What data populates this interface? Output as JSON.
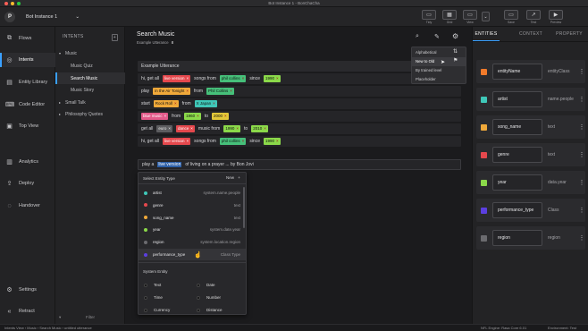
{
  "window": {
    "title": "Bot Instance 1 - BonChaCha",
    "traffic_colors": [
      "#ff5f57",
      "#febc2e",
      "#28c840"
    ]
  },
  "toolbar": {
    "avatar_letter": "P",
    "instance": "Bot Instance 1",
    "buttons_left": [
      {
        "label": "Tidy",
        "icon": "tidy-icon",
        "glyph": "▭"
      },
      {
        "label": "Grid",
        "icon": "grid-icon",
        "glyph": "▦"
      },
      {
        "label": "View",
        "icon": "view-icon",
        "glyph": "▭"
      }
    ],
    "buttons_right": [
      {
        "label": "Save",
        "icon": "save-icon",
        "glyph": "▭"
      },
      {
        "label": "Test",
        "icon": "test-icon",
        "glyph": "↗"
      },
      {
        "label": "Preview",
        "icon": "preview-icon",
        "glyph": "▶"
      }
    ]
  },
  "nav": [
    {
      "label": "Flows",
      "icon": "flows-icon",
      "glyph": "⧉"
    },
    {
      "label": "Intents",
      "icon": "intents-icon",
      "glyph": "◎",
      "active": true
    },
    {
      "label": "Entity Library",
      "icon": "entity-library-icon",
      "glyph": "▤"
    },
    {
      "label": "Code Editor",
      "icon": "code-editor-icon",
      "glyph": "⌨"
    },
    {
      "label": "Top View",
      "icon": "top-view-icon",
      "glyph": "▣"
    },
    {
      "label": "Analytics",
      "icon": "analytics-icon",
      "glyph": "▥"
    },
    {
      "label": "Deploy",
      "icon": "deploy-icon",
      "glyph": "⇪"
    },
    {
      "label": "Handover",
      "icon": "handover-icon",
      "glyph": "◌"
    },
    {
      "label": "Settings",
      "icon": "settings-icon",
      "glyph": "⚙"
    },
    {
      "label": "Retract",
      "icon": "retract-icon",
      "glyph": "«"
    }
  ],
  "intents": {
    "header": "INTENTS",
    "add": "+",
    "filter": "Filter",
    "tree": [
      {
        "label": "Music",
        "level": 0,
        "caret": "▾"
      },
      {
        "label": "Music Quiz",
        "level": 1
      },
      {
        "label": "Search Music",
        "level": 1,
        "selected": true
      },
      {
        "label": "Music Story",
        "level": 1
      },
      {
        "label": "Small Talk",
        "level": 0,
        "caret": "▸"
      },
      {
        "label": "Philosophy Quotes",
        "level": 0,
        "caret": "▸"
      }
    ]
  },
  "main": {
    "title": "Search Music",
    "subtitle_label": "Example Utterance",
    "subtitle_count": "8",
    "list_header": "Example Utterance",
    "utterances": [
      [
        {
          "t": "hi, get all"
        },
        {
          "k": "live version",
          "c": "red"
        },
        {
          "t": "songs from"
        },
        {
          "k": "phil collins",
          "c": "green"
        },
        {
          "t": "since"
        },
        {
          "k": "1990",
          "c": "lime"
        }
      ],
      [
        {
          "t": "play"
        },
        {
          "k": "in the Air Tonight",
          "c": "orange"
        },
        {
          "t": "from"
        },
        {
          "k": "Phil Collins",
          "c": "green"
        }
      ],
      [
        {
          "t": "start"
        },
        {
          "k": "Rock Roll",
          "c": "orange"
        },
        {
          "t": "from"
        },
        {
          "k": "X Japan",
          "c": "teal"
        }
      ],
      [
        {
          "k": "blue music",
          "c": "pink"
        },
        {
          "t": "from"
        },
        {
          "k": "1960",
          "c": "lime"
        },
        {
          "t": "to"
        },
        {
          "k": "2000",
          "c": "yellow"
        }
      ],
      [
        {
          "t": "get all"
        },
        {
          "k": "euro",
          "c": "gray"
        },
        {
          "k": "dance",
          "c": "red"
        },
        {
          "t": "music from"
        },
        {
          "k": "1990",
          "c": "lime"
        },
        {
          "t": "to"
        },
        {
          "k": "2010",
          "c": "lime"
        }
      ],
      [
        {
          "t": "hi, get all"
        },
        {
          "k": "live version",
          "c": "red"
        },
        {
          "t": "songs from"
        },
        {
          "k": "phil collins",
          "c": "green"
        },
        {
          "t": "since"
        },
        {
          "k": "1990",
          "c": "lime"
        }
      ]
    ],
    "editing": {
      "before": "play a",
      "highlight": "live version",
      "after": "of living on a prayer ... by Bon Jovi"
    }
  },
  "sort_menu": [
    "Alphabetical",
    "New to Old",
    "By trained level",
    "Placeholder"
  ],
  "entity_popup": {
    "title": "Select Entity Type",
    "new_label": "New",
    "entities": [
      {
        "name": "artist",
        "type": "system.name.people",
        "color": "#3fc7b8"
      },
      {
        "name": "genre",
        "type": "text",
        "color": "#e5484d"
      },
      {
        "name": "song_name",
        "type": "text",
        "color": "#f0a93a"
      },
      {
        "name": "year",
        "type": "system.date.year",
        "color": "#8bd94a"
      },
      {
        "name": "region",
        "type": "system.location.region",
        "color": "#6b6b6f"
      },
      {
        "name": "performance_type",
        "type": "Class Type",
        "color": "#5b3fe0",
        "hover": true
      }
    ],
    "system_title": "System Entity",
    "system": [
      [
        "Text",
        "Date"
      ],
      [
        "Time",
        "Number"
      ],
      [
        "Currency",
        "Distance"
      ]
    ]
  },
  "right_panel": {
    "tabs": [
      "ENTITIES",
      "CONTEXT",
      "PROPERTY"
    ],
    "entities": [
      {
        "name": "entityName",
        "type": "entityClass",
        "color": "#f07a2a"
      },
      {
        "name": "artist",
        "type": "name.people",
        "color": "#3fc7b8"
      },
      {
        "name": "song_name",
        "type": "text",
        "color": "#f0a93a"
      },
      {
        "name": "genre",
        "type": "text",
        "color": "#e5484d"
      },
      {
        "name": "year",
        "type": "data.year",
        "color": "#8bd94a"
      },
      {
        "name": "performance_type",
        "type": "Class",
        "color": "#5b3fe0"
      },
      {
        "name": "region",
        "type": "region",
        "color": "#6b6b6f"
      }
    ]
  },
  "status": {
    "breadcrumb": "Intents View › Music › Search Music › untitled utterance",
    "engine": "NFL Engine: Rasa Core 6.01",
    "env": "Environment: Test"
  }
}
